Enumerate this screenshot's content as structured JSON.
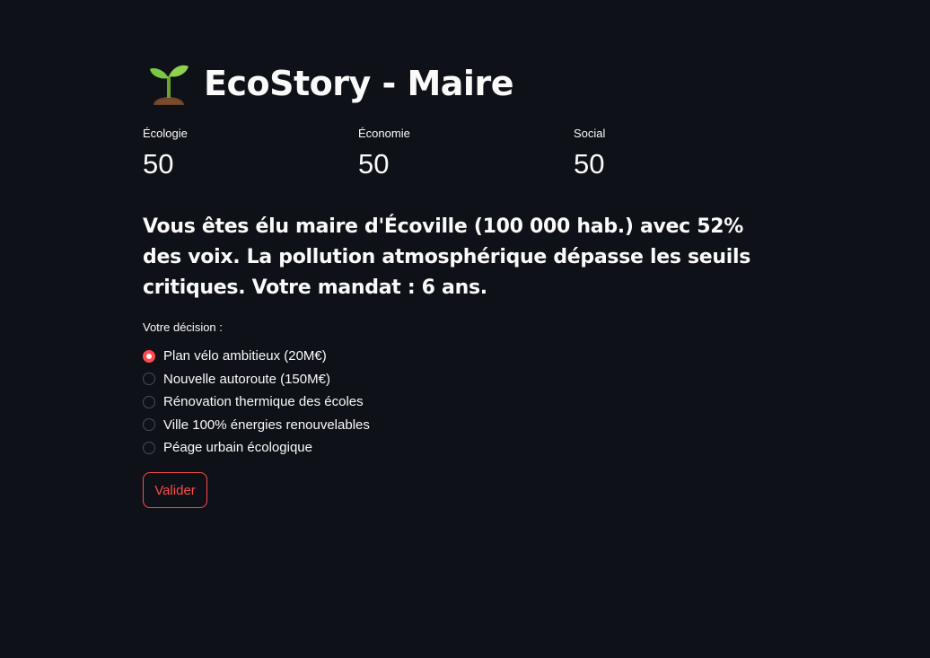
{
  "header": {
    "icon": "seedling-icon",
    "title": "EcoStory - Maire"
  },
  "metrics": [
    {
      "label": "Écologie",
      "value": "50"
    },
    {
      "label": "Économie",
      "value": "50"
    },
    {
      "label": "Social",
      "value": "50"
    }
  ],
  "story": {
    "text": "Vous êtes élu maire d'Écoville (100 000 hab.) avec 52% des voix. La pollution atmosphérique dépasse les seuils critiques. Votre mandat : 6 ans."
  },
  "decision": {
    "label": "Votre décision :",
    "selected_index": 0,
    "options": [
      "Plan vélo ambitieux (20M€)",
      "Nouvelle autoroute (150M€)",
      "Rénovation thermique des écoles",
      "Ville 100% énergies renouvelables",
      "Péage urbain écologique"
    ]
  },
  "actions": {
    "submit_label": "Valider"
  },
  "colors": {
    "background": "#0e1117",
    "text": "#fafafa",
    "accent": "#ff4b4b"
  }
}
